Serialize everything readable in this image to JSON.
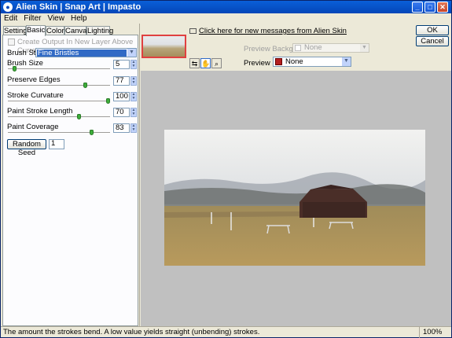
{
  "window": {
    "title": "Alien Skin | Snap Art | Impasto",
    "app_icon": "alien-skin-logo-icon",
    "controls": [
      "minimize-icon",
      "maximize-icon",
      "close-icon"
    ]
  },
  "menu": [
    "Edit",
    "Filter",
    "View",
    "Help"
  ],
  "tabs": [
    "Settings",
    "Basic",
    "Colors",
    "Canvas",
    "Lighting"
  ],
  "active_tab": "Basic",
  "panel": {
    "create_output_label": "Create Output In New Layer Above Current",
    "brush_style_label": "Brush Style:",
    "brush_style_value": "Fine Bristles",
    "controls": [
      {
        "label": "Brush Size",
        "value": "5",
        "level": 0.05
      },
      {
        "label": "Preserve Edges",
        "value": "77",
        "level": 0.77
      },
      {
        "label": "Stroke Curvature",
        "value": "100",
        "level": 1.0
      },
      {
        "label": "Paint Stroke Length",
        "value": "70",
        "level": 0.7
      },
      {
        "label": "Paint Coverage",
        "value": "83",
        "level": 0.83
      }
    ],
    "random_seed_label": "Random Seed",
    "random_seed_value": "1"
  },
  "preview": {
    "message_link": "Click here for new messages from Alien Skin",
    "background_label": "Preview Background:",
    "background_value": "None",
    "split_label": "Preview Split:",
    "split_value": "None",
    "split_color": "#b41e1e",
    "tools": [
      "compare-icon",
      "hand-pan-icon",
      "zoom-magnifier-icon"
    ]
  },
  "buttons": {
    "ok": "OK",
    "cancel": "Cancel"
  },
  "status": {
    "text": "The amount the strokes bend. A low value yields straight (unbending) strokes.",
    "zoom": "100%"
  }
}
